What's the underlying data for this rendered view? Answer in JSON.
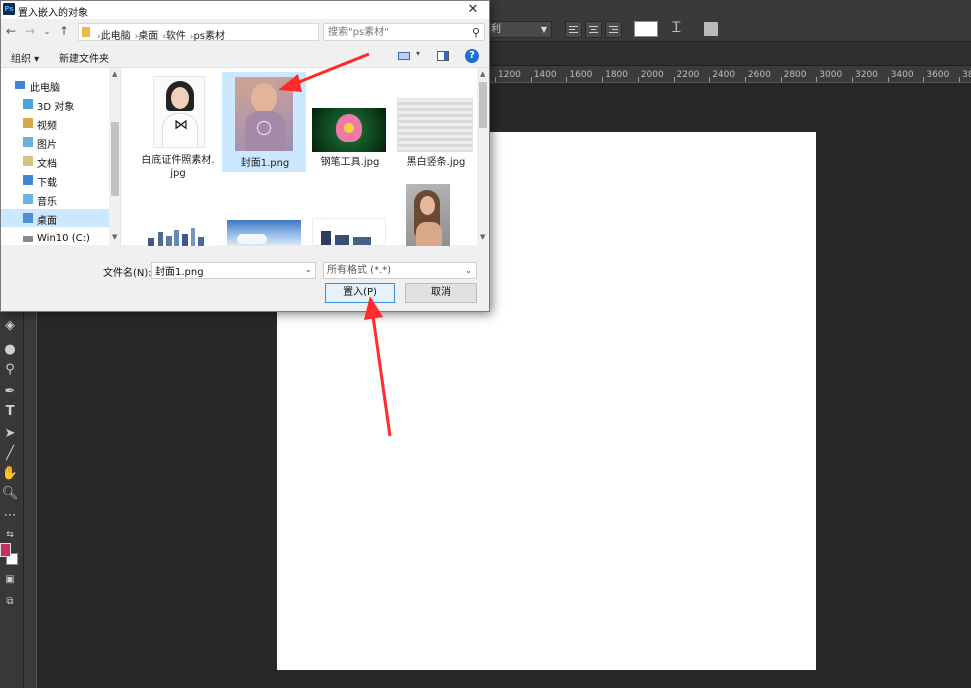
{
  "dialog": {
    "title": "置入嵌入的对象",
    "app_icon": "Ps"
  },
  "address": {
    "crumbs": [
      "此电脑",
      "桌面",
      "软件",
      "ps素材"
    ]
  },
  "search": {
    "placeholder": "搜索\"ps素材\""
  },
  "commands": {
    "organize": "组织 ▾",
    "new_folder": "新建文件夹"
  },
  "nav_items": [
    {
      "label": "此电脑",
      "icon": "computer-icon"
    },
    {
      "label": "3D 对象",
      "icon": "3d-objects-icon"
    },
    {
      "label": "视频",
      "icon": "video-folder-icon"
    },
    {
      "label": "图片",
      "icon": "pictures-folder-icon"
    },
    {
      "label": "文档",
      "icon": "documents-folder-icon"
    },
    {
      "label": "下载",
      "icon": "downloads-folder-icon"
    },
    {
      "label": "音乐",
      "icon": "music-folder-icon"
    },
    {
      "label": "桌面",
      "icon": "desktop-folder-icon",
      "selected": true
    },
    {
      "label": "Win10 (C:)",
      "icon": "drive-icon"
    }
  ],
  "files": [
    {
      "name": "白底证件照素材.jpg",
      "line1": "白底证件照素材.",
      "line2": "jpg"
    },
    {
      "name": "封面1.png",
      "line1": "封面1.png",
      "selected": true
    },
    {
      "name": "钢笔工具.jpg",
      "line1": "钢笔工具.jpg"
    },
    {
      "name": "黑白竖条.jpg",
      "line1": "黑白竖条.jpg"
    },
    {
      "name": "city-skyline"
    },
    {
      "name": "sky-clouds"
    },
    {
      "name": "buildings"
    },
    {
      "name": "woman-portrait"
    }
  ],
  "bottom": {
    "filename_label": "文件名(N):",
    "filename_value": "封面1.png",
    "filetype": "所有格式 (*.*)",
    "place_button": "置入(P)",
    "cancel_button": "取消"
  },
  "photoshop": {
    "font_style": "利",
    "ruler_ticks": [
      "1200",
      "1400",
      "1600",
      "1800",
      "2000",
      "2200",
      "2400",
      "2600",
      "2800",
      "3000",
      "3200",
      "3400",
      "3600",
      "38"
    ],
    "foreground_color": "#c4335f",
    "background_color": "#ffffff"
  },
  "annotation_color": "#ff2a2a"
}
